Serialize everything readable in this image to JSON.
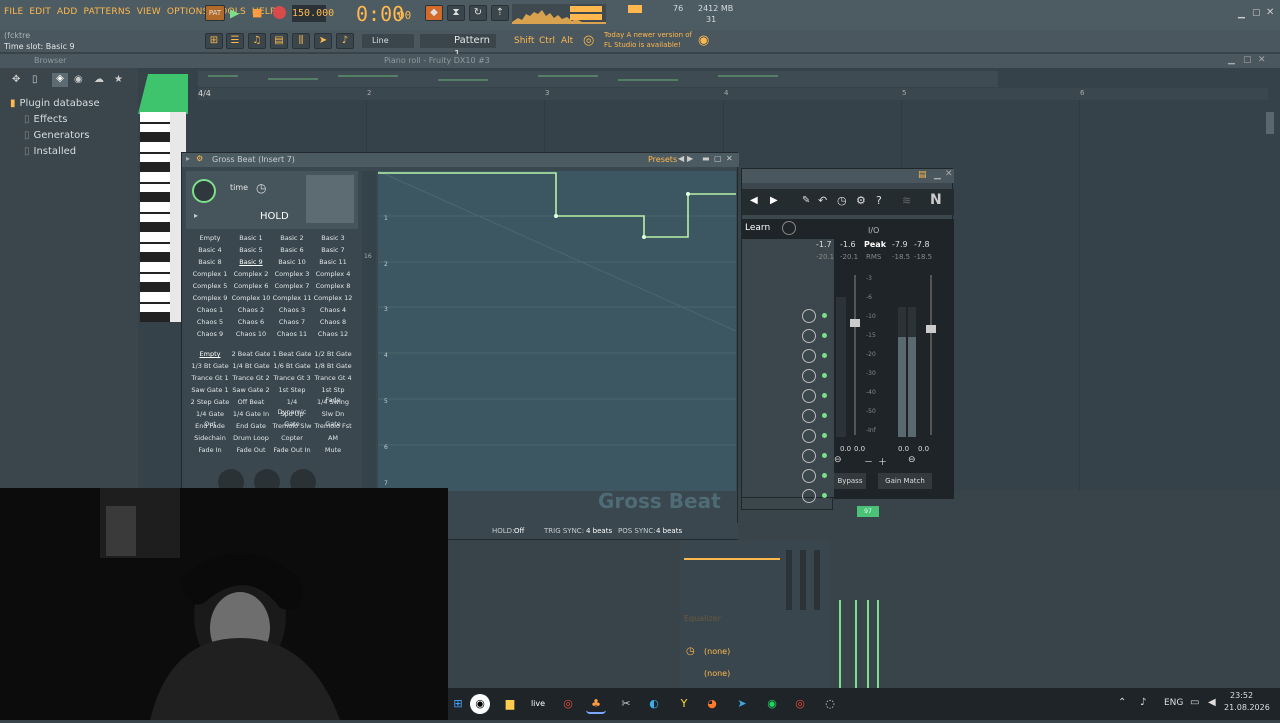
{
  "menu": [
    "FILE",
    "EDIT",
    "ADD",
    "PATTERNS",
    "VIEW",
    "OPTIONS",
    "TOOLS",
    "HELP"
  ],
  "transport": {
    "tempo": "150.000",
    "time": "0:00",
    "time_sub": "00",
    "cpu": "76",
    "memory": "2412 MB",
    "voices": "31"
  },
  "hint": {
    "line1": "(fcktre",
    "line2": "Time slot: Basic 9"
  },
  "toolbar2": {
    "snap": "Line",
    "pattern": "Pattern 1",
    "shift": "Shift",
    "ctrl": "Ctrl",
    "alt": "Alt",
    "news1": "Today  A newer version of",
    "news2": "FL Studio is available!"
  },
  "browser": {
    "title": "Browser",
    "items": [
      "Plugin database",
      "Effects",
      "Generators",
      "Installed"
    ]
  },
  "pianoroll": {
    "title": "Piano roll - Fruity DX10 #3",
    "signature": "4/4",
    "bars": [
      "2",
      "3",
      "4",
      "5",
      "6"
    ]
  },
  "grossbeat": {
    "title": "Gross Beat (Insert 7)",
    "presets_label": "Presets",
    "time_label": "time",
    "hold_label": "HOLD",
    "time_presets": [
      [
        "Empty",
        "Basic 1",
        "Basic 2",
        "Basic 3"
      ],
      [
        "Basic 4",
        "Basic 5",
        "Basic 6",
        "Basic 7"
      ],
      [
        "Basic 8",
        "Basic 9",
        "Basic 10",
        "Basic 11"
      ],
      [
        "Complex 1",
        "Complex 2",
        "Complex 3",
        "Complex 4"
      ],
      [
        "Complex 5",
        "Complex 6",
        "Complex 7",
        "Complex 8"
      ],
      [
        "Complex 9",
        "Complex 10",
        "Complex 11",
        "Complex 12"
      ],
      [
        "Chaos 1",
        "Chaos 2",
        "Chaos 3",
        "Chaos 4"
      ],
      [
        "Chaos 5",
        "Chaos 6",
        "Chaos 7",
        "Chaos 8"
      ],
      [
        "Chaos 9",
        "Chaos 10",
        "Chaos 11",
        "Chaos 12"
      ]
    ],
    "volume_presets": [
      [
        "Empty",
        "2 Beat Gate",
        "1 Beat Gate",
        "1/2 Bt Gate"
      ],
      [
        "1/3 Bt Gate",
        "1/4 Bt Gate",
        "1/6 Bt Gate",
        "1/8 Bt Gate"
      ],
      [
        "Trance Gt 1",
        "Trance Gt 2",
        "Trance Gt 3",
        "Trance Gt 4"
      ],
      [
        "Saw Gate 1",
        "Saw Gate 2",
        "1st Step",
        "1st Stp Fade"
      ],
      [
        "2 Step Gate",
        "Off Beat",
        "1/4 Dynamic",
        "1/4 Swing"
      ],
      [
        "1/4 Gate Out",
        "1/4 Gate In",
        "Spd Up Gate",
        "Slw Dn Gate"
      ],
      [
        "End Fade",
        "End Gate",
        "Tremolo Slw",
        "Tremolo Fst"
      ],
      [
        "Sidechain",
        "Drum Loop",
        "Copter",
        "AM"
      ],
      [
        "Fade In",
        "Fade Out",
        "Fade Out In",
        "Mute"
      ]
    ],
    "side_numbers": [
      "16",
      "8"
    ],
    "graph_labels": [
      "1",
      "2",
      "3",
      "4",
      "5",
      "6",
      "7"
    ],
    "watermark": "Gross Beat",
    "footer": {
      "hold": "HOLD:",
      "hold_val": "Off",
      "trig": "TRIG SYNC:",
      "trig_val": "4 beats",
      "pos": "POS SYNC:",
      "pos_val": "4 beats"
    }
  },
  "meter": {
    "learn": "Learn",
    "io": "I/O",
    "values": [
      "-1.7",
      "-1.6",
      "Peak",
      "-7.9",
      "-7.8"
    ],
    "rms_values": [
      "-20.1",
      "-20.1",
      "RMS",
      "-18.5",
      "-18.5"
    ],
    "scale": [
      "-3",
      "-6",
      "-10",
      "-15",
      "-20",
      "-30",
      "-40",
      "-50",
      "-Inf"
    ],
    "in_vals": [
      "0.0",
      "0.0"
    ],
    "out_vals": [
      "0.0",
      "0.0"
    ],
    "bypass": "Bypass",
    "gain_match": "Gain Match",
    "logo": "N"
  },
  "mixer_lower": {
    "eq": "Equalizer",
    "slot1": "(none)",
    "slot2": "(none)",
    "insert": "97"
  },
  "taskbar": {
    "lang": "ENG",
    "time": "23:52",
    "date": "21.08.2026"
  },
  "colors": {
    "accent": "#ffb84d",
    "green": "#7ce08a",
    "bg": "#39434a"
  }
}
